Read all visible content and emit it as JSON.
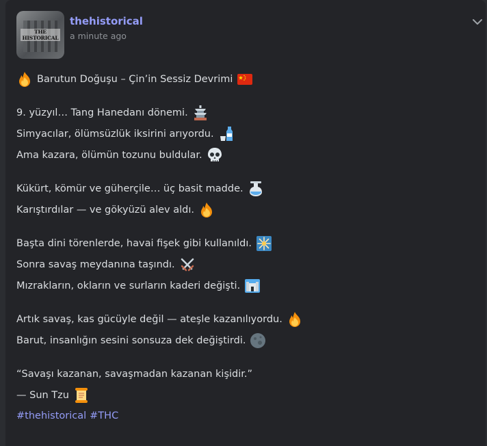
{
  "post": {
    "username": "thehistorical",
    "timestamp": "a minute ago",
    "avatar_text": "THE HISTORICAL",
    "lines": [
      "Barutun Doğuşu – Çin’in Sessiz Devrimi",
      "9. yüzyıl… Tang Hanedanı dönemi.",
      "Simyacılar, ölümsüzlük iksirini arıyordu.",
      "Ama kazara, ölümün tozunu buldular.",
      "Kükürt, kömür ve güherçile… üç basit madde.",
      "Karıştırdılar — ve gökyüzü alev aldı.",
      "Başta dini törenlerde, havai fişek gibi kullanıldı.",
      "Sonra savaş meydanına taşındı.",
      "Mızrakların, okların ve surların kaderi değişti.",
      "Artık savaş, kas gücüyle değil — ateşle kazanılıyordu.",
      "Barut, insanlığın sesini sonsuza dek değiştirdi.",
      "“Savaşı kazanan, savaşmadan kazanan kişidir.”",
      "— Sun Tzu"
    ],
    "emojis": [
      "fire-icon",
      "china-flag-icon",
      "pagoda-icon",
      "sake-icon",
      "skull-icon",
      "flask-icon",
      "fire-icon",
      "fireworks-icon",
      "crossed-swords-icon",
      "castle-icon",
      "fire-icon",
      "moon-icon",
      "scroll-icon"
    ],
    "hashtags": [
      "#thehistorical",
      "#THC"
    ]
  },
  "colors": {
    "username": "#949cf7",
    "hashtag": "#949cf7",
    "text": "#dbdee1",
    "muted": "#8e9297",
    "background": "#232428"
  }
}
